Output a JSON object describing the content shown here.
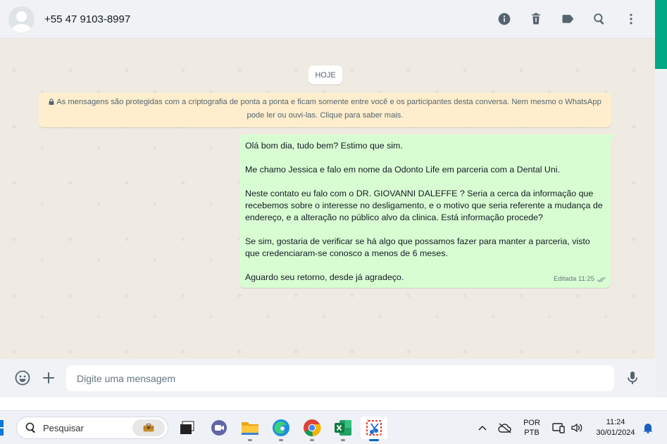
{
  "header": {
    "contact_name": "+55 47 9103-8997",
    "icons": [
      "info-icon",
      "delete-icon",
      "label-icon",
      "search-icon",
      "menu-icon"
    ]
  },
  "chat": {
    "date_label": "HOJE",
    "encryption_notice_line1": "As mensagens são protegidas com a criptografia de ponta a ponta e ficam somente entre você e os participantes desta conversa. Nem mesmo o WhatsApp",
    "encryption_notice_line2": "pode ler ou ouvi-las. Clique para saber mais.",
    "message": {
      "paragraphs": [
        "Olá bom dia, tudo bem? Estimo que sim.",
        "Me chamo Jessica e falo em nome da Odonto Life em parceria com a Dental Uni.",
        "Neste contato eu falo com o DR. GIOVANNI DALEFFE ? Seria a cerca da informação que recebemos sobre o interesse no desligamento, e o motivo que seria referente a mudança de endereço, e a alteração no público alvo da clinica. Está informação procede?",
        "Se sim, gostaria de verificar se há algo que possamos fazer para manter a parceria, visto que credenciaram-se conosco a menos de 6 meses.",
        "Aguardo seu retorno, desde já agradeço."
      ],
      "meta": "Editada 11:25"
    }
  },
  "composer": {
    "placeholder": "Digite uma mensagem"
  },
  "taskbar": {
    "search_placeholder": "Pesquisar",
    "language_line1": "POR",
    "language_line2": "PTB",
    "time": "11:24",
    "date": "30/01/2024"
  },
  "colors": {
    "accent": "#00a884",
    "bubble_out": "#d9fdd3",
    "notice_bg": "#ffeecd",
    "chat_bg": "#efeae2"
  }
}
